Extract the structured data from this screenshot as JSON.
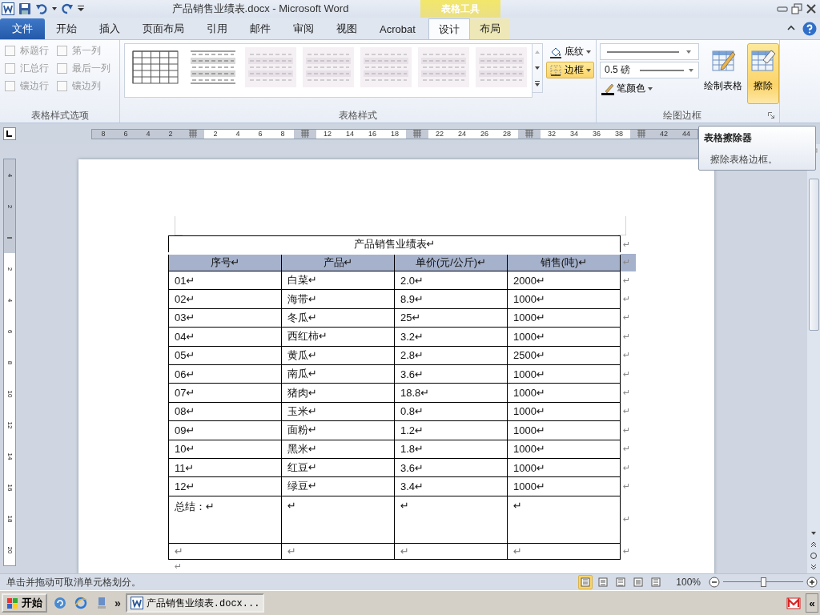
{
  "title_bar": {
    "title": "产品销售业绩表.docx  -  Microsoft Word",
    "context_label": "表格工具"
  },
  "tabs": [
    {
      "label": "文件",
      "kind": "file",
      "selected": false
    },
    {
      "label": "开始",
      "kind": "main",
      "selected": false
    },
    {
      "label": "插入",
      "kind": "main",
      "selected": false
    },
    {
      "label": "页面布局",
      "kind": "main",
      "selected": false
    },
    {
      "label": "引用",
      "kind": "main",
      "selected": false
    },
    {
      "label": "邮件",
      "kind": "main",
      "selected": false
    },
    {
      "label": "审阅",
      "kind": "main",
      "selected": false
    },
    {
      "label": "视图",
      "kind": "main",
      "selected": false
    },
    {
      "label": "Acrobat",
      "kind": "main",
      "selected": false
    },
    {
      "label": "设计",
      "kind": "context",
      "selected": true
    },
    {
      "label": "布局",
      "kind": "context",
      "selected": false
    }
  ],
  "style_options": {
    "title": "表格样式选项",
    "items": [
      {
        "label": "标题行",
        "checked": false
      },
      {
        "label": "汇总行",
        "checked": false
      },
      {
        "label": "镶边行",
        "checked": false
      },
      {
        "label": "第一列",
        "checked": false
      },
      {
        "label": "最后一列",
        "checked": false
      },
      {
        "label": "镶边列",
        "checked": false
      }
    ]
  },
  "table_styles": {
    "title": "表格样式",
    "thumbnails": [
      {
        "kind": "grid"
      },
      {
        "kind": "banded"
      },
      {
        "kind": "light"
      },
      {
        "kind": "light"
      },
      {
        "kind": "light"
      },
      {
        "kind": "light"
      },
      {
        "kind": "light"
      }
    ],
    "shading": {
      "label": "底纹"
    },
    "borders": {
      "label": "边框",
      "selected": true
    }
  },
  "draw_borders": {
    "title": "绘图边框",
    "line_weight": "0.5 磅",
    "pen_color": "笔颜色",
    "draw_table": "绘制表格",
    "eraser": {
      "label": "擦除",
      "selected": true
    }
  },
  "ruler": [
    {
      "kind": "margin",
      "text": "8"
    },
    {
      "kind": "margin",
      "text": "6"
    },
    {
      "kind": "margin",
      "text": "4"
    },
    {
      "kind": "margin",
      "text": "2"
    },
    {
      "kind": "marker"
    },
    {
      "kind": "num",
      "text": "2"
    },
    {
      "kind": "num",
      "text": "4"
    },
    {
      "kind": "num",
      "text": "6"
    },
    {
      "kind": "num",
      "text": "8"
    },
    {
      "kind": "marker"
    },
    {
      "kind": "num",
      "text": "12"
    },
    {
      "kind": "num",
      "text": "14"
    },
    {
      "kind": "num",
      "text": "16"
    },
    {
      "kind": "num",
      "text": "18"
    },
    {
      "kind": "marker"
    },
    {
      "kind": "num",
      "text": "22"
    },
    {
      "kind": "num",
      "text": "24"
    },
    {
      "kind": "num",
      "text": "26"
    },
    {
      "kind": "num",
      "text": "28"
    },
    {
      "kind": "marker"
    },
    {
      "kind": "num",
      "text": "32"
    },
    {
      "kind": "num",
      "text": "34"
    },
    {
      "kind": "num",
      "text": "36"
    },
    {
      "kind": "num",
      "text": "38"
    },
    {
      "kind": "marker"
    },
    {
      "kind": "margin",
      "text": "42"
    },
    {
      "kind": "margin",
      "text": "44"
    }
  ],
  "vertical_ruler": [
    {
      "kind": "margin",
      "text": "4"
    },
    {
      "kind": "margin",
      "text": "2"
    },
    {
      "kind": "marker"
    },
    {
      "kind": "num",
      "text": "2"
    },
    {
      "kind": "num",
      "text": "4"
    },
    {
      "kind": "num",
      "text": "6"
    },
    {
      "kind": "num",
      "text": "8"
    },
    {
      "kind": "num",
      "text": "10"
    },
    {
      "kind": "num",
      "text": "12"
    },
    {
      "kind": "num",
      "text": "14"
    },
    {
      "kind": "num",
      "text": "16"
    },
    {
      "kind": "num",
      "text": "18"
    },
    {
      "kind": "num",
      "text": "20"
    }
  ],
  "tooltip": {
    "title": "表格擦除器",
    "text": "擦除表格边框。"
  },
  "document": {
    "caption": "产品销售业绩表↵",
    "caption_end": "↵",
    "columns": [
      "序号↵",
      "产品↵",
      "单价(元/公斤)↵",
      "销售(吨)↵"
    ],
    "header_end": "↵",
    "rows": [
      {
        "cells": [
          "01↵",
          "白菜↵",
          "2.0↵",
          "2000↵"
        ],
        "end": "↵"
      },
      {
        "cells": [
          "02↵",
          "海带↵",
          "8.9↵",
          "1000↵"
        ],
        "end": "↵"
      },
      {
        "cells": [
          "03↵",
          "冬瓜↵",
          "25↵",
          "1000↵"
        ],
        "end": "↵"
      },
      {
        "cells": [
          "04↵",
          "西红柿↵",
          "3.2↵",
          "1000↵"
        ],
        "end": "↵"
      },
      {
        "cells": [
          "05↵",
          "黄瓜↵",
          "2.8↵",
          "2500↵"
        ],
        "end": "↵"
      },
      {
        "cells": [
          "06↵",
          "南瓜↵",
          "3.6↵",
          "1000↵"
        ],
        "end": "↵"
      },
      {
        "cells": [
          "07↵",
          "猪肉↵",
          "18.8↵",
          "1000↵"
        ],
        "end": "↵"
      },
      {
        "cells": [
          "08↵",
          "玉米↵",
          "0.8↵",
          "1000↵"
        ],
        "end": "↵"
      },
      {
        "cells": [
          "09↵",
          "面粉↵",
          "1.2↵",
          "1000↵"
        ],
        "end": "↵"
      },
      {
        "cells": [
          "10↵",
          "黑米↵",
          "1.8↵",
          "1000↵"
        ],
        "end": "↵"
      },
      {
        "cells": [
          "11↵",
          "红豆↵",
          "3.6↵",
          "1000↵"
        ],
        "end": "↵"
      },
      {
        "cells": [
          "12↵",
          "绿豆↵",
          "3.4↵",
          "1000↵"
        ],
        "end": "↵"
      }
    ],
    "summary": {
      "cells": [
        "总结：↵",
        "↵",
        "↵",
        "↵"
      ],
      "end": "↵"
    },
    "last_row": {
      "cells": [
        "↵",
        "↵",
        "↵",
        "↵"
      ],
      "end": "↵"
    },
    "after_table": "↵"
  },
  "status_bar": {
    "message": "单击并拖动可取消单元格划分。",
    "views": [
      {
        "selected": true
      },
      {
        "selected": false
      },
      {
        "selected": false
      },
      {
        "selected": false
      },
      {
        "selected": false
      }
    ],
    "zoom": "100%",
    "zoom_slider": {
      "level": 0.5
    }
  },
  "taskbar": {
    "start": "开始",
    "more": "»",
    "task": "产品销售业绩表.docx...",
    "expand": "«"
  }
}
